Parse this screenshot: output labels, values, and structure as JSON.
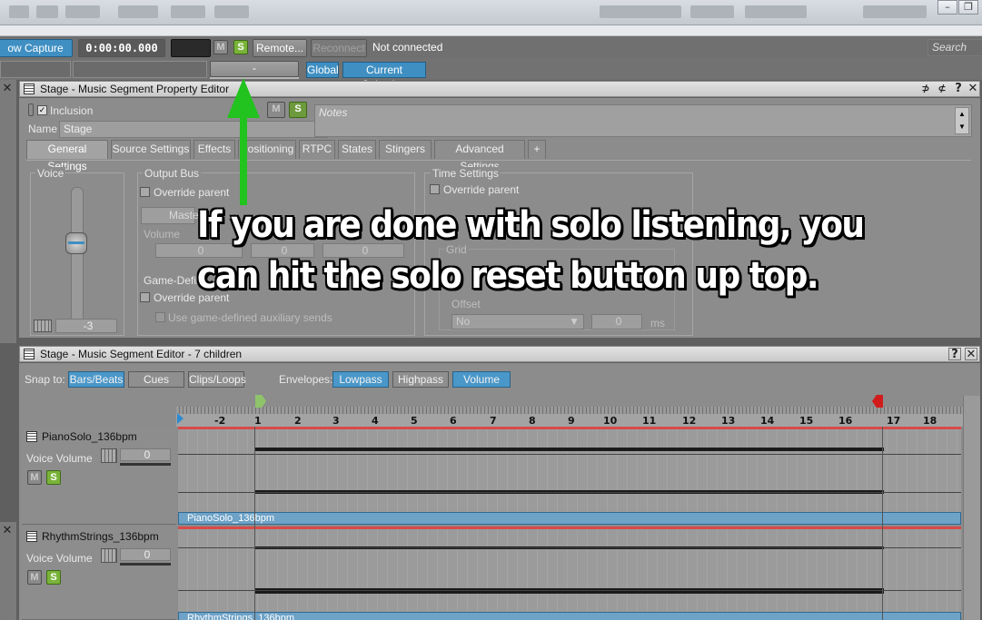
{
  "transport": {
    "capture_button": "ow Capture Time",
    "time": "0:00:00.000",
    "mute": "M",
    "solo": "S",
    "remote": "Remote...",
    "reconnect": "Reconnect",
    "status": "Not connected",
    "search_placeholder": "Search",
    "reset_label": "-",
    "global": "Global",
    "current_selection": "Current Selection"
  },
  "property_editor": {
    "title": "Stage - Music Segment Property Editor",
    "inclusion": "Inclusion",
    "name_label": "Name",
    "name_value": "Stage",
    "notes_placeholder": "Notes",
    "mute": "M",
    "solo": "S",
    "tabs": [
      "General Settings",
      "Source Settings",
      "Effects",
      "Positioning",
      "RTPC",
      "States",
      "Stingers",
      "Advanced Settings",
      "+"
    ],
    "voice_group": "Voice",
    "voice_value": "-3",
    "output_bus": "Output Bus",
    "override_parent": "Override parent",
    "master_partial": "Maste",
    "volume_label": "Volume",
    "zero": "0",
    "game_defined": "Game-Defin",
    "game_override": "Override parent",
    "use_game_aux": "Use game-defined auxiliary sends",
    "time_settings": "Time Settings",
    "time_override": "Override parent",
    "grid": "Grid",
    "offset": "Offset",
    "offset_select": "No",
    "offset_value": "0",
    "offset_unit": "ms"
  },
  "segment_editor": {
    "title": "Stage - Music Segment Editor - 7 children",
    "snap_to": "Snap to:",
    "snap_buttons": [
      "Bars/Beats",
      "Cues",
      "Clips/Loops"
    ],
    "envelopes": "Envelopes:",
    "envelope_buttons": [
      "Lowpass",
      "Highpass",
      "Volume"
    ],
    "ruler": [
      "-2",
      "1",
      "2",
      "3",
      "4",
      "5",
      "6",
      "7",
      "8",
      "9",
      "10",
      "11",
      "12",
      "13",
      "14",
      "15",
      "16",
      "17",
      "18"
    ],
    "tracks": [
      {
        "name": "PianoSolo_136bpm",
        "volume_label": "Voice Volume",
        "volume": "0",
        "mute": "M",
        "solo": "S",
        "clip": "PianoSolo_136bpm"
      },
      {
        "name": "RhythmStrings_136bpm",
        "volume_label": "Voice Volume",
        "volume": "0",
        "mute": "M",
        "solo": "S",
        "clip": "RhythmStrings_136bpm"
      }
    ]
  },
  "annotation": {
    "line1": "If you are done with solo listening, you",
    "line2": "can hit the solo reset button up top.",
    "arrow_color": "#22c21f"
  },
  "colors": {
    "solo_green": "#7ab33a",
    "accent_blue": "#3f8fc2",
    "playhead_red": "#d21b1b"
  }
}
